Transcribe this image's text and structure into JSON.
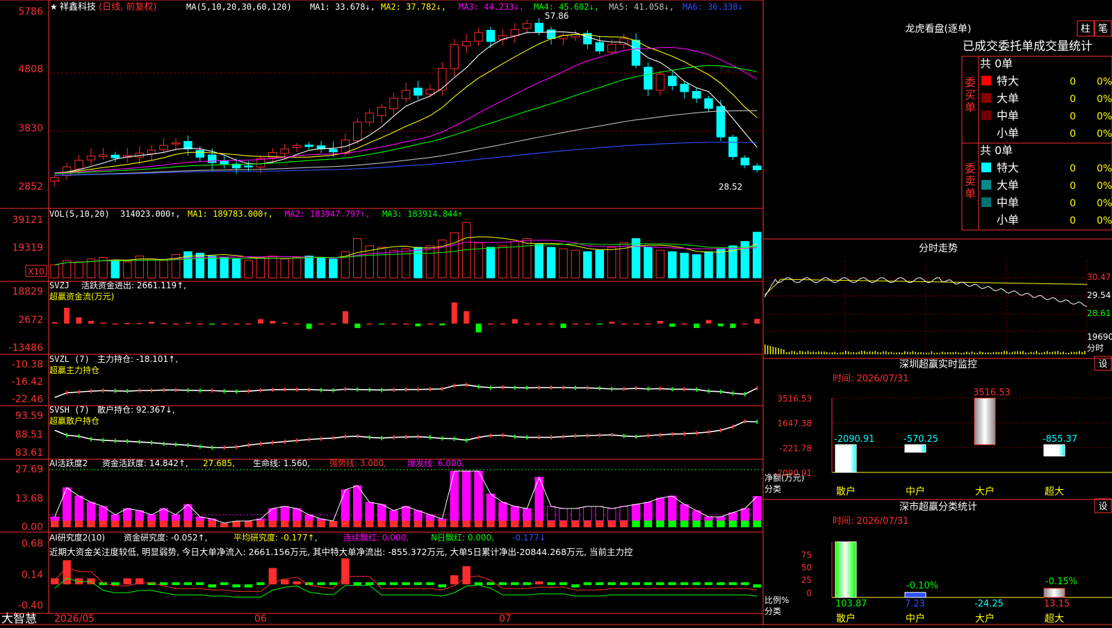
{
  "colors": {
    "up": "#ff2d2d",
    "down": "#00ffff",
    "grid": "#8b0000",
    "ma1": "#ffffff",
    "ma2": "#ffff00",
    "ma3": "#ff00ff",
    "ma4": "#00ff00",
    "ma5": "#c0c0c0",
    "ma6": "#3050ff",
    "accent": "#ff3030"
  },
  "header": {
    "star": "★",
    "name": "祥鑫科技",
    "mode": "(日线, 前复权)",
    "ma_params": "MA(5,10,20,30,60,120)",
    "ma1": "MA1: 33.678↓,",
    "ma2": "MA2: 37.782↓,",
    "ma3": "MA3: 44.233↓,",
    "ma4": "MA4: 45.602↓,",
    "ma5": "MA5: 41.058↓,",
    "ma6": "MA6: 36.338↓"
  },
  "main_axis": {
    "ticks": [
      "5786",
      "4808",
      "3830",
      "2852"
    ],
    "high_label": "57.86",
    "low_label": "28.52"
  },
  "vol": {
    "label": "VOL(5,10,20)",
    "value": "314023.000↑,",
    "ma1": "MA1: 189783.000↑,",
    "ma2": "MA2: 183947.797↑,",
    "ma3": "MA3: 183914.844↑",
    "ticks": [
      "39121",
      "19319"
    ],
    "unit": "X10"
  },
  "svzj": {
    "label": "SVZJ",
    "text": "活跃资金进出: 2661.119↑,",
    "sub": "超赢资金流(万元)",
    "ticks": [
      "18829",
      "2672",
      "-13486"
    ]
  },
  "svzl": {
    "label": "SVZL (7)",
    "text": "主力持仓: -18.101↑,",
    "sub": "超赢主力持仓",
    "ticks": [
      "-10.38",
      "-16.42",
      "-22.46"
    ]
  },
  "svsh": {
    "label": "SVSH (7)",
    "text": "散户持仓: 92.367↓,",
    "sub": "超赢散户持仓",
    "ticks": [
      "93.59",
      "88.51",
      "83.61"
    ]
  },
  "ai1": {
    "label": "AI活跃度2",
    "a": "资金活跃度: 14.842↑,",
    "b": "27.685,",
    "c": "生命线: 1.560,",
    "d": "强势线: 3.000,",
    "e": "爆发线: 6.000,",
    "ticks": [
      "27.69",
      "13.68",
      "0.00"
    ]
  },
  "ai2": {
    "label": "AI研究度2(10)",
    "a": "资金研究度: -0.052↑,",
    "b": "平均研究度: -0.177↑,",
    "c": "连续飘红: 0.000,",
    "d": "N日飘红: 0.000,",
    "e": "-0.177↓",
    "comment": "近期大资金关注度较低, 明显弱势, 今日大单净流入: 2661.156万元, 其中特大单净流出: -855.372万元, 大单5日累计净出-20844.268万元, 当前主力控",
    "ticks": [
      "0.68",
      "0.14",
      "-0.40"
    ]
  },
  "footer": {
    "brand": "大智慧",
    "date1": "2026/05",
    "date2": "06",
    "date3": "07"
  },
  "right": {
    "dragon_title": "龙虎看盘(逐单)",
    "btn_zhu": "柱",
    "btn_bi": "笔",
    "order_title": "已成交委托单成交量统计",
    "buy_label": "委买单",
    "sell_label": "委卖单",
    "buy_total": "共 0单",
    "sell_total": "共 0单",
    "buy_rows": [
      {
        "name": "特大",
        "count": "0",
        "pct": "0%"
      },
      {
        "name": "大单",
        "count": "0",
        "pct": "0%"
      },
      {
        "name": "中单",
        "count": "0",
        "pct": "0%"
      },
      {
        "name": "小单",
        "count": "0",
        "pct": "0%"
      }
    ],
    "sell_rows": [
      {
        "name": "特大",
        "count": "0",
        "pct": "0%"
      },
      {
        "name": "大单",
        "count": "0",
        "pct": "0%"
      },
      {
        "name": "中单",
        "count": "0",
        "pct": "0%"
      },
      {
        "name": "小单",
        "count": "0",
        "pct": "0%"
      }
    ],
    "minute_title": "分时走势",
    "minute_ticks": [
      "30.47",
      "29.54",
      "28.61"
    ],
    "minute_vol": "19690",
    "minute_label": "分时",
    "monitor_title": "深圳超赢实时监控",
    "monitor_time": "时间: 2026/07/31",
    "settings": "设",
    "net_label": "净额(万元)",
    "class_label": "分类",
    "stat_title": "深市超赢分类统计",
    "stat_time": "时间: 2026/07/31",
    "ratio_label": "比例%",
    "stat_ticks": [
      "75",
      "50",
      "25",
      "0"
    ]
  },
  "chart_data": [
    {
      "type": "candlestick",
      "title": "祥鑫科技 (日线, 前复权)",
      "x": [
        "2026/05",
        "06",
        "07"
      ],
      "ylim": [
        28.52,
        57.86
      ],
      "high": 57.86,
      "low": 28.52,
      "closes": [
        30.2,
        32.0,
        33.1,
        33.8,
        34.0,
        33.5,
        33.9,
        34.3,
        34.8,
        35.6,
        36.0,
        35.0,
        33.6,
        32.7,
        32.5,
        31.8,
        32.0,
        33.4,
        34.4,
        35.0,
        35.6,
        35.4,
        35.0,
        34.5,
        36.5,
        39.5,
        41.0,
        42.0,
        43.5,
        44.8,
        44.0,
        45.0,
        48.5,
        52.5,
        53.0,
        54.5,
        53.0,
        54.0,
        55.0,
        56.0,
        54.6,
        53.5,
        54.0,
        54.2,
        52.6,
        51.4,
        52.5,
        53.5,
        49.0,
        45.0,
        47.5,
        45.6,
        44.6,
        43.5,
        41.8,
        37.0,
        33.7,
        32.3,
        31.5
      ],
      "ma": [
        {
          "name": "MA1",
          "value": 33.678
        },
        {
          "name": "MA2",
          "value": 37.782
        },
        {
          "name": "MA3",
          "value": 44.233
        },
        {
          "name": "MA4",
          "value": 45.602
        },
        {
          "name": "MA5",
          "value": 41.058
        },
        {
          "name": "MA6",
          "value": 36.338
        }
      ]
    },
    {
      "type": "bar",
      "title": "VOL(5,10,20)",
      "ylim": [
        0,
        39121
      ],
      "values": [
        9000,
        12000,
        11000,
        13000,
        14000,
        12000,
        11000,
        15000,
        13000,
        12000,
        16000,
        18000,
        17000,
        15000,
        14000,
        13000,
        12000,
        14000,
        15000,
        13000,
        14000,
        15000,
        14000,
        13000,
        18000,
        27000,
        22000,
        21000,
        19000,
        20000,
        21000,
        22000,
        26000,
        31000,
        38000,
        24000,
        21000,
        22000,
        25000,
        27000,
        23000,
        21000,
        20000,
        19000,
        18000,
        19000,
        21000,
        24000,
        27000,
        21000,
        19000,
        18000,
        17000,
        16000,
        18000,
        20000,
        22000,
        25000,
        31402
      ],
      "series": [
        {
          "name": "MA1",
          "value": 189783.0
        },
        {
          "name": "MA2",
          "value": 183947.797
        },
        {
          "name": "MA3",
          "value": 183914.844
        }
      ]
    },
    {
      "type": "bar",
      "title": "超赢资金流(万元)",
      "ylim": [
        -13486,
        18829
      ],
      "values": [
        800,
        9000,
        3500,
        1500,
        500,
        0,
        300,
        300,
        1000,
        300,
        0,
        500,
        0,
        -500,
        100,
        0,
        0,
        2500,
        1500,
        500,
        0,
        -3000,
        0,
        0,
        7000,
        -2500,
        0,
        -500,
        0,
        0,
        -1500,
        0,
        -1000,
        12000,
        7000,
        -5000,
        0,
        0,
        2500,
        0,
        0,
        0,
        -2500,
        0,
        0,
        -500,
        1000,
        0,
        0,
        0,
        1500,
        -1800,
        0,
        -2500,
        2000,
        -1500,
        -2500,
        0,
        2661
      ]
    },
    {
      "type": "line",
      "title": "超赢主力持仓",
      "ylim": [
        -22.46,
        -10.38
      ],
      "values": [
        -21.5,
        -19.8,
        -19.5,
        -19.2,
        -19.0,
        -19.1,
        -19.2,
        -19.0,
        -19.0,
        -18.8,
        -18.8,
        -18.9,
        -19.0,
        -19.0,
        -19.2,
        -19.3,
        -19.2,
        -18.9,
        -18.7,
        -18.6,
        -18.6,
        -18.6,
        -18.8,
        -18.9,
        -18.5,
        -18.6,
        -18.7,
        -18.8,
        -18.7,
        -18.6,
        -18.6,
        -18.5,
        -18.4,
        -17.2,
        -16.9,
        -17.6,
        -17.9,
        -17.8,
        -17.9,
        -18.0,
        -17.9,
        -17.9,
        -17.9,
        -18.0,
        -18.0,
        -18.2,
        -18.4,
        -18.4,
        -18.2,
        -18.4,
        -18.3,
        -18.5,
        -18.5,
        -18.6,
        -19.2,
        -19.4,
        -20.0,
        -20.3,
        -18.101
      ]
    },
    {
      "type": "line",
      "title": "超赢散户持仓",
      "ylim": [
        83.61,
        93.59
      ],
      "values": [
        90.0,
        88.6,
        88.3,
        87.5,
        87.2,
        87.0,
        86.9,
        86.7,
        86.5,
        86.2,
        86.0,
        85.8,
        85.4,
        85.1,
        85.1,
        85.3,
        85.8,
        86.2,
        86.5,
        86.8,
        87.1,
        87.4,
        87.6,
        87.8,
        88.2,
        88.3,
        88.0,
        87.8,
        88.0,
        88.1,
        88.2,
        88.0,
        87.7,
        87.6,
        87.2,
        88.0,
        88.5,
        88.6,
        88.2,
        88.0,
        88.0,
        88.0,
        88.2,
        88.4,
        88.5,
        88.6,
        88.7,
        88.4,
        88.2,
        88.5,
        88.7,
        88.9,
        89.0,
        89.2,
        89.5,
        90.0,
        91.0,
        92.5,
        92.367
      ]
    },
    {
      "type": "bar",
      "title": "AI活跃度2",
      "ylim": [
        0,
        27.69
      ],
      "values": [
        5,
        19,
        15,
        12,
        10,
        6,
        9,
        8,
        6,
        9,
        6,
        11,
        5,
        4,
        2,
        3,
        3,
        4,
        9,
        10,
        9,
        6,
        4,
        3,
        18,
        20,
        12,
        11,
        8,
        10,
        8,
        6,
        4,
        27,
        27,
        27,
        16,
        12,
        10,
        9,
        24,
        10,
        9,
        9,
        10,
        10,
        9,
        10,
        11,
        12,
        14,
        15,
        11,
        8,
        5,
        5,
        7,
        9,
        14.842
      ],
      "series": [
        {
          "name": "生命线",
          "value": 1.56
        },
        {
          "name": "强势线",
          "value": 3.0
        },
        {
          "name": "爆发线",
          "value": 6.0
        }
      ]
    },
    {
      "type": "bar",
      "title": "AI研究度2(10)",
      "ylim": [
        -0.4,
        0.68
      ],
      "values": [
        0.1,
        0.4,
        0.1,
        0.1,
        0.0,
        0.0,
        0.1,
        0.1,
        0.0,
        0.0,
        0.0,
        0.0,
        0.0,
        -0.05,
        0.0,
        -0.05,
        -0.05,
        0.0,
        0.27,
        0.08,
        0.05,
        0.0,
        0.0,
        0.0,
        0.43,
        0.0,
        0.0,
        0.0,
        0.0,
        0.0,
        0.0,
        0.0,
        -0.05,
        0.15,
        0.3,
        0.0,
        0.0,
        0.0,
        0.0,
        0.0,
        0.05,
        0.0,
        0.0,
        -0.05,
        0.0,
        0.0,
        0.0,
        0.0,
        0.0,
        0.0,
        0.0,
        0.0,
        0.0,
        0.0,
        0.0,
        0.0,
        0.0,
        0.0,
        -0.052
      ]
    },
    {
      "type": "bar",
      "title": "深圳超赢实时监控",
      "categories": [
        "散户",
        "中户",
        "大户",
        "超大"
      ],
      "values": [
        -2090.91,
        -570.25,
        3516.53,
        -855.37
      ],
      "ylim": [
        -2090.91,
        3516.53
      ],
      "ylabel": "净额(万元)",
      "xlabel": "分类",
      "ticks": [
        "3516.53",
        "1647.38",
        "-221.78",
        "-2090.91"
      ]
    },
    {
      "type": "bar",
      "title": "深市超赢分类统计",
      "categories": [
        "散户",
        "中户",
        "大户",
        "超大"
      ],
      "values": [
        103.87,
        7.23,
        -24.25,
        13.15
      ],
      "labels": [
        "",
        "-0.10%",
        "",
        "-0.15%"
      ],
      "ylim": [
        0,
        75
      ],
      "ylabel": "比例%",
      "xlabel": "分类"
    },
    {
      "type": "line",
      "title": "分时走势",
      "ylim": [
        28.61,
        30.47
      ]
    }
  ]
}
